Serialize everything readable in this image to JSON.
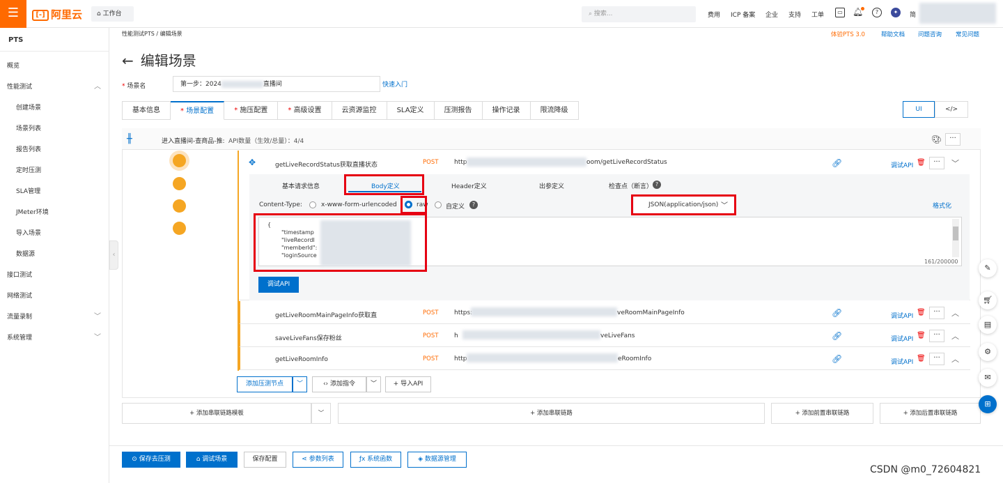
{
  "topbar": {
    "menu_icon": "menu-icon",
    "logo_text": "阿里云",
    "workspace": "工作台",
    "search_placeholder": "搜索...",
    "links": [
      "费用",
      "ICP 备案",
      "企业",
      "支持",
      "工单"
    ],
    "user_name": "简"
  },
  "sidebar": {
    "title": "PTS",
    "items": [
      {
        "label": "概览"
      },
      {
        "label": "性能测试",
        "expanded": true
      },
      {
        "label": "创建场景"
      },
      {
        "label": "场景列表"
      },
      {
        "label": "报告列表"
      },
      {
        "label": "定时压测"
      },
      {
        "label": "SLA管理"
      },
      {
        "label": "JMeter环境"
      },
      {
        "label": "导入场景"
      },
      {
        "label": "数据源"
      },
      {
        "label": "接口测试"
      },
      {
        "label": "网络测试"
      },
      {
        "label": "流量录制"
      },
      {
        "label": "系统管理"
      }
    ]
  },
  "header": {
    "breadcrumb_root": "性能测试PTS",
    "breadcrumb_current": "编辑场景",
    "links": [
      "体验PTS 3.0",
      "帮助文档",
      "问题咨询",
      "常见问题"
    ],
    "title": "编辑场景"
  },
  "form": {
    "scene_name_label": "场景名",
    "scene_name_value_a": "第一步：2024",
    "scene_name_value_b": "直播间",
    "quick_start": "快速入门"
  },
  "tabs": [
    "基本信息",
    "场景配置",
    "施压配置",
    "高级设置",
    "云资源监控",
    "SLA定义",
    "压测报告",
    "操作记录",
    "限流降级"
  ],
  "view_toggle": {
    "ui": "UI",
    "code": "</>"
  },
  "chain": {
    "name": "进入直播间-查商品-推:",
    "api_count_label": "API数量（生效/总量）：4/4"
  },
  "apis": [
    {
      "name": "getLiveRecordStatus获取直播状态",
      "method": "POST",
      "url_start": "http",
      "url_end": "oom/getLiveRecordStatus",
      "debug": "调试API"
    },
    {
      "name": "getLiveRoomMainPageInfo获取直",
      "method": "POST",
      "url_start": "https:",
      "url_end": "veRoomMainPageInfo",
      "debug": "调试API"
    },
    {
      "name": "saveLiveFans保存粉丝",
      "method": "POST",
      "url_start": "h",
      "url_end": "veLiveFans",
      "debug": "调试API"
    },
    {
      "name": "getLiveRoomInfo",
      "method": "POST",
      "url_start": "http",
      "url_end": "eRoomInfo",
      "debug": "调试API"
    }
  ],
  "api_detail": {
    "subtabs": [
      "基本请求信息",
      "Body定义",
      "Header定义",
      "出参定义",
      "检查点（断言）"
    ],
    "content_type_label": "Content-Type:",
    "options": [
      "x-www-form-urlencoded",
      "raw",
      "自定义"
    ],
    "format_select": "JSON(application/json)",
    "format_link": "格式化",
    "body_lines": [
      "{",
      "\"timestamp",
      "\"liveRecordI",
      "\"memberId\":",
      "\"loginSource"
    ],
    "char_count": "161/200000",
    "debug_button": "调试API"
  },
  "toolbar": {
    "add_node": "添加压测节点",
    "add_command": "添加指令",
    "import_api": "+ 导入API"
  },
  "add_links": {
    "template": "+ 添加串联链路模板",
    "chain": "+ 添加串联链路",
    "pre_chain": "+ 添加前置串联链路",
    "post_chain": "+ 添加后置串联链路"
  },
  "bottom": {
    "save_test": "保存去压测",
    "debug_scene": "调试场景",
    "save_config": "保存配置",
    "param_list": "参数列表",
    "sys_func": "系统函数",
    "datasource": "数据源管理"
  },
  "watermark": "CSDN @m0_72604821",
  "colors": {
    "brand": "#ff6a00",
    "primary": "#0070cc",
    "highlight": "#e60012"
  }
}
